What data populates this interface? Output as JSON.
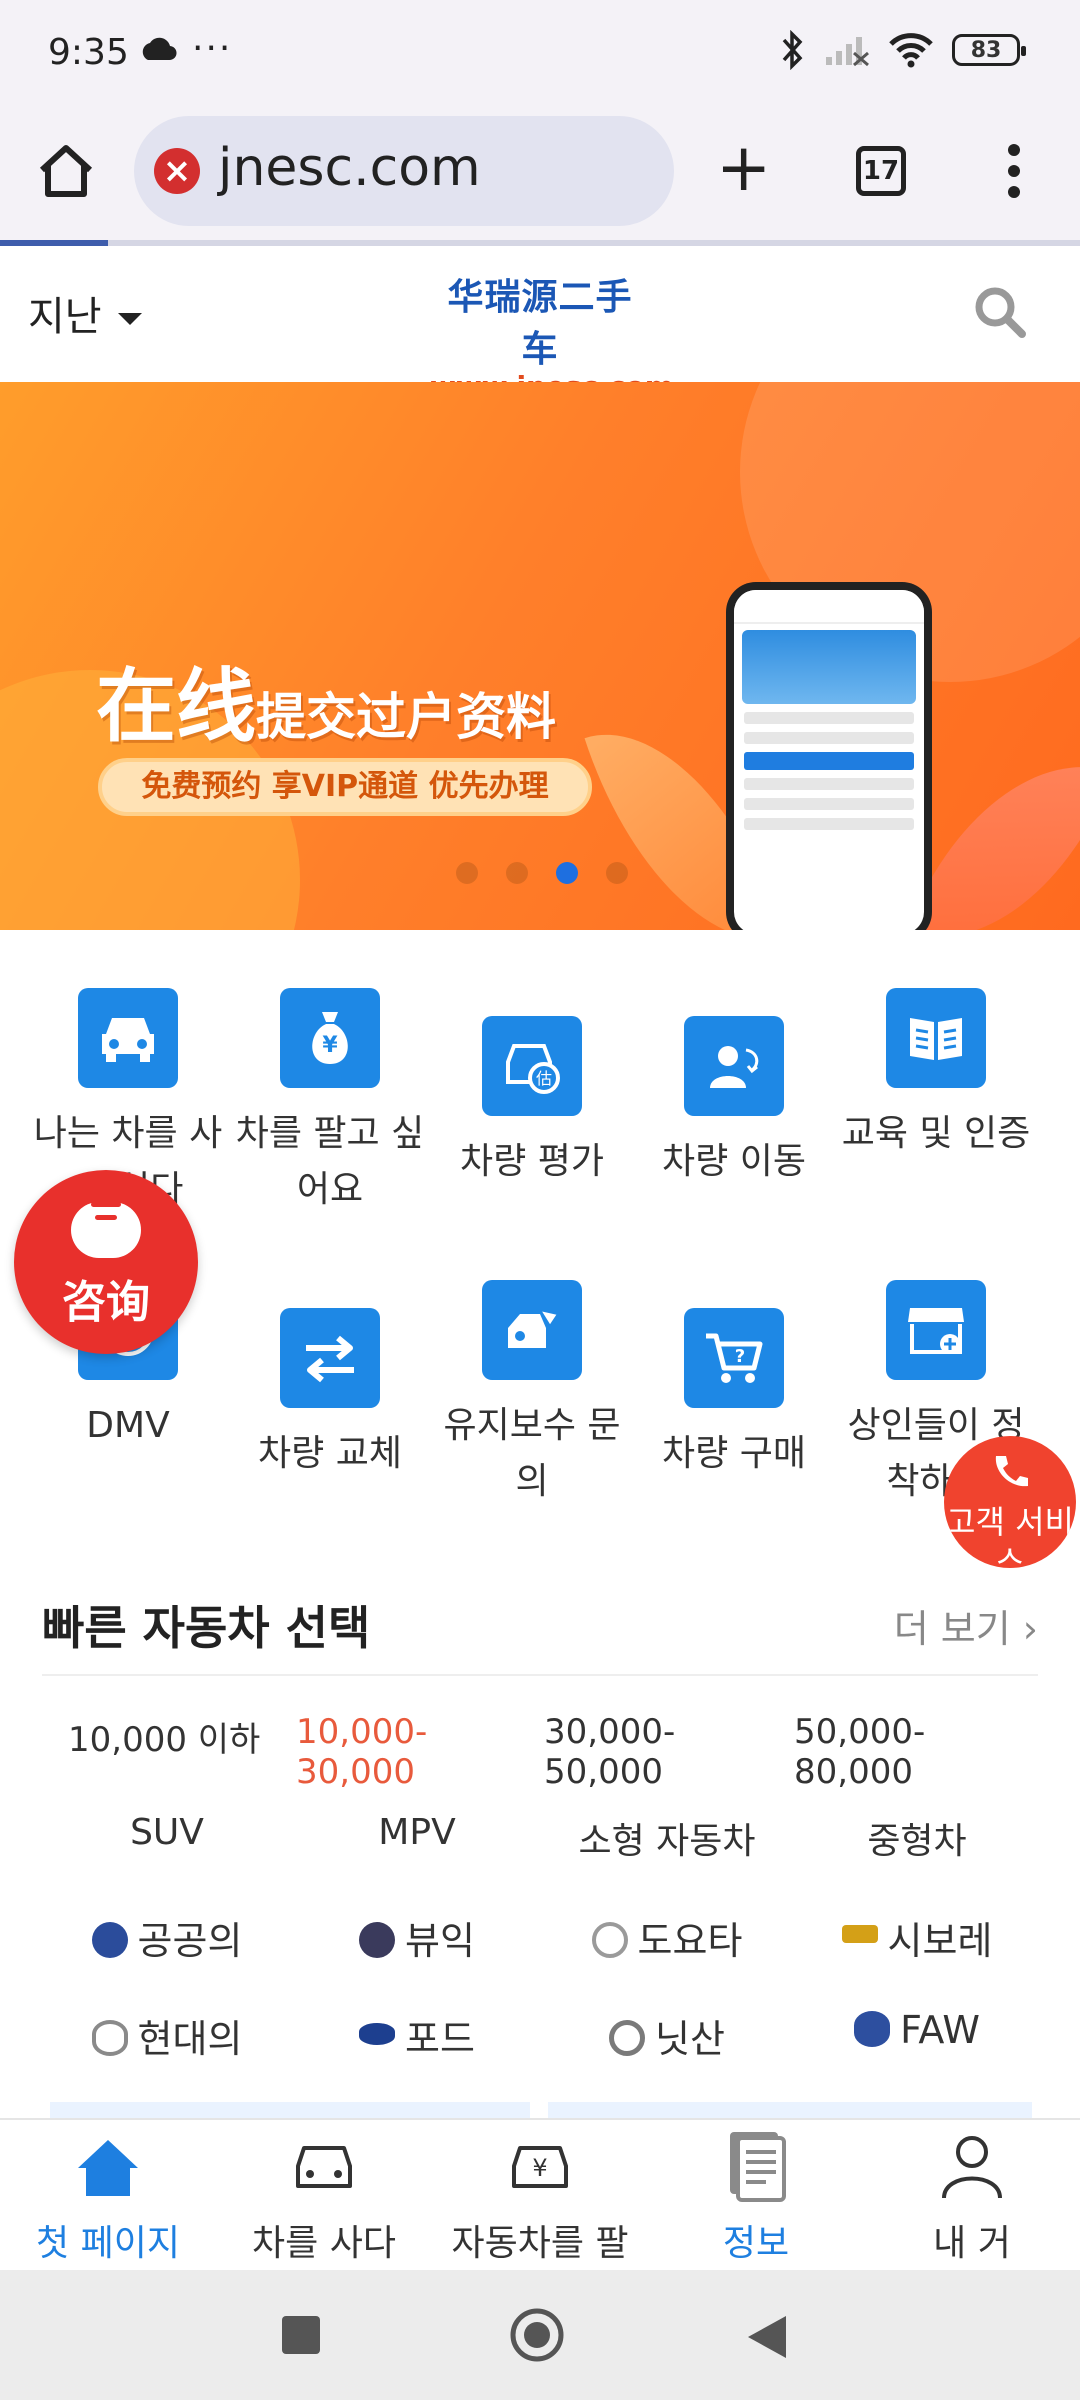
{
  "status_bar": {
    "time": "9:35",
    "dots": "···",
    "battery": "83",
    "icons": [
      "cloud-icon",
      "bluetooth-icon",
      "signal-icon",
      "wifi-icon",
      "battery-icon"
    ]
  },
  "browser": {
    "url": "jnesc.com",
    "security_warning": "×",
    "tab_count": "17",
    "new_tab": "+"
  },
  "site_header": {
    "city": "지난",
    "logo_cn": "华瑞源二手车",
    "logo_url": "www.jnesc.com"
  },
  "banner": {
    "title_big": "在线",
    "title_small": "提交过户资料",
    "pill": "免费预约  享VIP通道  优先办理",
    "slides": 4,
    "active_slide": 3
  },
  "grid": {
    "items": [
      {
        "label": "나는 차를 사고 싶다",
        "icon": "car-icon"
      },
      {
        "label": "차를 팔고 싶어요",
        "icon": "money-bag-icon"
      },
      {
        "label": "차량 평가",
        "icon": "car-estimate-icon"
      },
      {
        "label": "차량 이동",
        "icon": "user-transfer-icon"
      },
      {
        "label": "교육 및 인증",
        "icon": "book-icon"
      },
      {
        "label": "DMV",
        "icon": "dmv-icon"
      },
      {
        "label": "차량 교체",
        "icon": "swap-icon"
      },
      {
        "label": "유지보수 문의",
        "icon": "wrench-icon"
      },
      {
        "label": "차량 구매",
        "icon": "cart-icon"
      },
      {
        "label": "상인들이 정착하다",
        "icon": "store-icon"
      }
    ]
  },
  "floating": {
    "consult_label": "咨询",
    "service_label": "고객 서비스"
  },
  "quick_select": {
    "title": "빠른 자동차 선택",
    "more": "더 보기",
    "prices": [
      "10,000 이하",
      "10,000-30,000",
      "30,000-50,000",
      "50,000-80,000"
    ],
    "active_price": 1,
    "types": [
      "SUV",
      "MPV",
      "소형 자동차",
      "중형차"
    ],
    "brands": [
      {
        "name": "공공의",
        "color": "#2b4c9b"
      },
      {
        "name": "뷰익",
        "color": "#3a3a5c"
      },
      {
        "name": "도요타",
        "color": "#9a9a9a"
      },
      {
        "name": "시보레",
        "color": "#d4a017"
      },
      {
        "name": "현대의",
        "color": "#8a8a8a"
      },
      {
        "name": "포드",
        "color": "#1d3f8f"
      },
      {
        "name": "닛산",
        "color": "#7a7a7a"
      },
      {
        "name": "FAW",
        "color": "#2d4f9f"
      }
    ]
  },
  "bottom_nav": {
    "items": [
      {
        "label": "첫 페이지",
        "icon": "home-icon",
        "active": true
      },
      {
        "label": "차를 사다",
        "icon": "car-outline-icon",
        "active": false
      },
      {
        "label": "자동차를 팔",
        "icon": "car-yen-icon",
        "active": false
      },
      {
        "label": "정보",
        "icon": "document-icon",
        "active": true
      },
      {
        "label": "내 거",
        "icon": "person-icon",
        "active": false
      }
    ]
  },
  "colors": {
    "accent_blue": "#1e88e5",
    "active_price": "#e85a3c",
    "banner_orange": "#ff7f2a",
    "float_red": "#e8302c"
  }
}
